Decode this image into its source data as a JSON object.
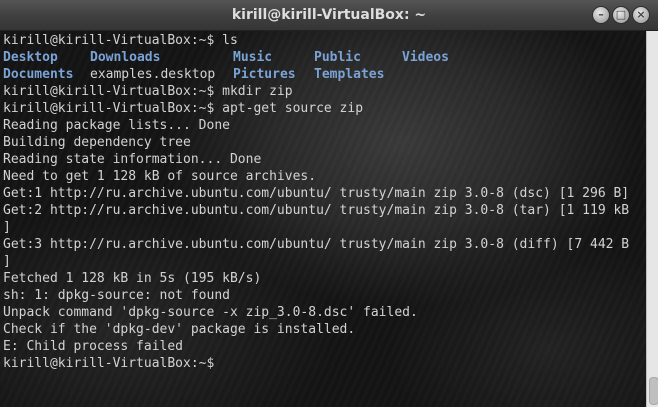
{
  "window": {
    "title": "kirill@kirill-VirtualBox: ~"
  },
  "icons": [
    "minimize-icon",
    "maximize-icon",
    "close-icon"
  ],
  "terminal": {
    "prompt1": "kirill@kirill-VirtualBox:~$ ls",
    "ls_row1": [
      "Desktop",
      "Downloads",
      "Music",
      "Public",
      "Videos"
    ],
    "ls_row2_dir1": "Documents",
    "ls_row2_file": "examples.desktop",
    "ls_row2_dir2": "Pictures",
    "ls_row2_dir3": "Templates",
    "lines": [
      "kirill@kirill-VirtualBox:~$ mkdir zip",
      "kirill@kirill-VirtualBox:~$ apt-get source zip",
      "Reading package lists... Done",
      "Building dependency tree",
      "Reading state information... Done",
      "Need to get 1 128 kB of source archives.",
      "Get:1 http://ru.archive.ubuntu.com/ubuntu/ trusty/main zip 3.0-8 (dsc) [1 296 B]",
      "Get:2 http://ru.archive.ubuntu.com/ubuntu/ trusty/main zip 3.0-8 (tar) [1 119 kB",
      "]",
      "Get:3 http://ru.archive.ubuntu.com/ubuntu/ trusty/main zip 3.0-8 (diff) [7 442 B",
      "]",
      "Fetched 1 128 kB in 5s (195 kB/s)",
      "sh: 1: dpkg-source: not found",
      "Unpack command 'dpkg-source -x zip_3.0-8.dsc' failed.",
      "Check if the 'dpkg-dev' package is installed.",
      "E: Child process failed",
      "kirill@kirill-VirtualBox:~$"
    ]
  }
}
